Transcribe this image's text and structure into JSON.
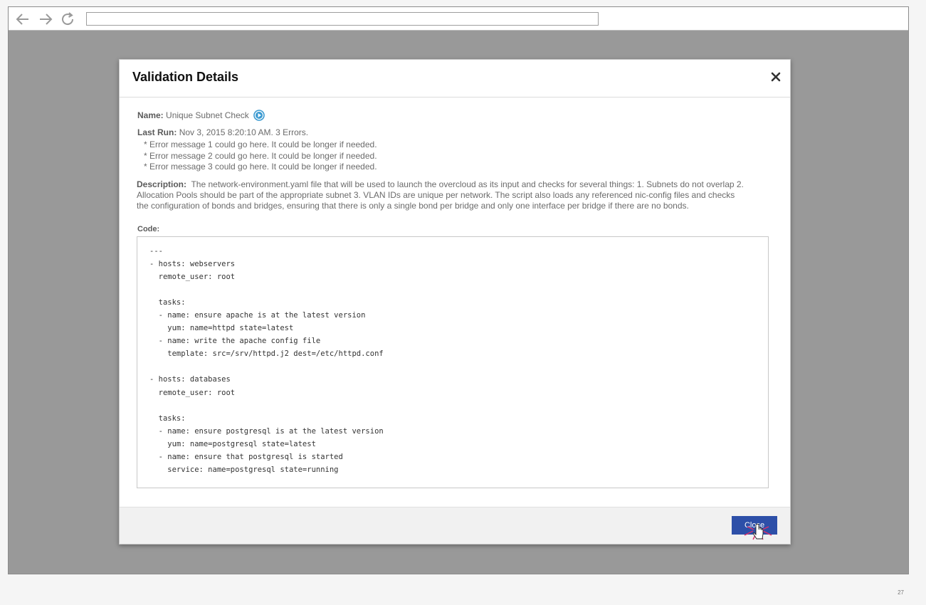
{
  "browser": {
    "back_icon": "arrow-left-icon",
    "forward_icon": "arrow-right-icon",
    "reload_icon": "reload-icon",
    "url": ""
  },
  "modal": {
    "title": "Validation Details",
    "close_icon": "close-x-icon",
    "name_label": "Name:",
    "name_value": "Unique Subnet Check",
    "run_icon": "play-circle-icon",
    "last_run_label": "Last Run:",
    "last_run_value": "Nov 3, 2015 8:20:10 AM. 3 Errors.",
    "errors": [
      "* Error message 1 could go here. It could be longer if needed.",
      "* Error message 2 could go here. It could be longer if needed.",
      "* Error message 3 could go here. It could be longer if needed."
    ],
    "description_label": "Description:",
    "description_text": "The network-environment.yaml file that will be used to launch the overcloud as its input and checks for several things: 1. Subnets do not overlap 2. Allocation Pools should be part of the appropriate subnet 3. VLAN IDs are unique per network. The script also loads any referenced nic-config files and checks the configuration of bonds and bridges, ensuring that there is only a single bond per bridge and only one interface per bridge if there are no bonds.",
    "code_label": "Code:",
    "code": "---\n- hosts: webservers\n  remote_user: root\n\n  tasks:\n  - name: ensure apache is at the latest version\n    yum: name=httpd state=latest\n  - name: write the apache config file\n    template: src=/srv/httpd.j2 dest=/etc/httpd.conf\n\n- hosts: databases\n  remote_user: root\n\n  tasks:\n  - name: ensure postgresql is at the latest version\n    yum: name=postgresql state=latest\n  - name: ensure that postgresql is started\n    service: name=postgresql state=running",
    "close_button_label": "Close",
    "cursor_icon": "hand-pointer-click-icon"
  },
  "colors": {
    "overlay": "#999999",
    "button": "#2d4fa8",
    "run_icon": "#3b9ad1"
  },
  "page_number": "27"
}
